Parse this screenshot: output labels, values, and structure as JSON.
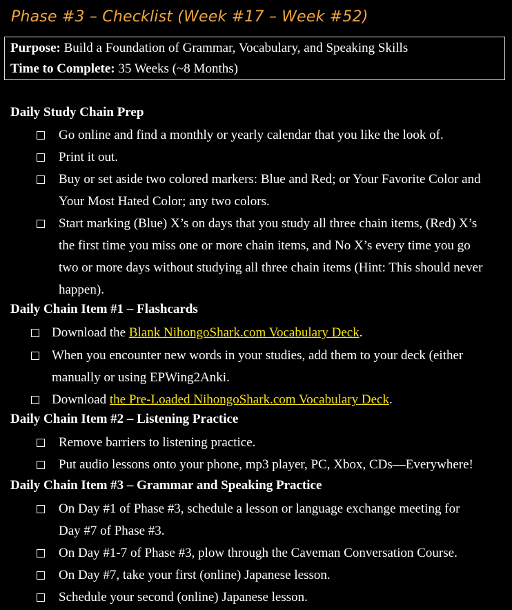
{
  "title": "Phase #3 – Checklist (Week #17 – Week #52)",
  "summary": {
    "purpose_label": "Purpose:",
    "purpose_value": "Build a Foundation of Grammar, Vocabulary, and Speaking Skills",
    "time_label": "Time to Complete:",
    "time_value": "35 Weeks (~8 Months)"
  },
  "sections": [
    {
      "heading": "Daily Study Chain Prep",
      "items": [
        {
          "lines": [
            "Go online and find a monthly or yearly calendar that you like the look of."
          ]
        },
        {
          "lines": [
            "Print it out."
          ]
        },
        {
          "lines": [
            "Buy or set aside two colored markers: Blue and Red; or Your Favorite Color and",
            "Your Most Hated Color; any two colors."
          ]
        },
        {
          "lines": [
            "Start marking (Blue) X’s on days that you study all three chain items, (Red) X’s",
            "the first time you miss one or more chain items, and No X’s every time you go",
            "two or more days without studying all three chain items (Hint: This should never",
            "happen)."
          ]
        }
      ]
    },
    {
      "heading": "Daily Chain Item #1 – Flashcards",
      "items": [
        {
          "pre": "Download the ",
          "link": "Blank NihongoShark.com Vocabulary Deck",
          "post": "."
        },
        {
          "lines": [
            "When you encounter new words in your studies, add them to your deck (either",
            "manually or using EPWing2Anki."
          ]
        },
        {
          "pre": "Download ",
          "link": "the Pre-Loaded NihongoShark.com Vocabulary Deck",
          "post": "."
        }
      ]
    },
    {
      "heading": "Daily Chain Item #2 – Listening Practice",
      "items": [
        {
          "lines": [
            "Remove barriers to listening practice."
          ]
        },
        {
          "lines": [
            "Put audio lessons onto your phone, mp3 player, PC, Xbox, CDs—Everywhere!"
          ]
        }
      ]
    },
    {
      "heading": "Daily Chain Item #3 – Grammar and Speaking Practice",
      "items": [
        {
          "lines": [
            "On Day #1 of Phase #3, schedule a lesson or language exchange meeting for",
            "Day #7 of Phase #3."
          ]
        },
        {
          "lines": [
            "On Day #1-7 of Phase #3, plow through the Caveman Conversation Course."
          ]
        },
        {
          "lines": [
            "On Day #7, take your first (online) Japanese lesson."
          ]
        },
        {
          "lines": [
            "Schedule your second (online) Japanese lesson."
          ]
        }
      ]
    }
  ]
}
